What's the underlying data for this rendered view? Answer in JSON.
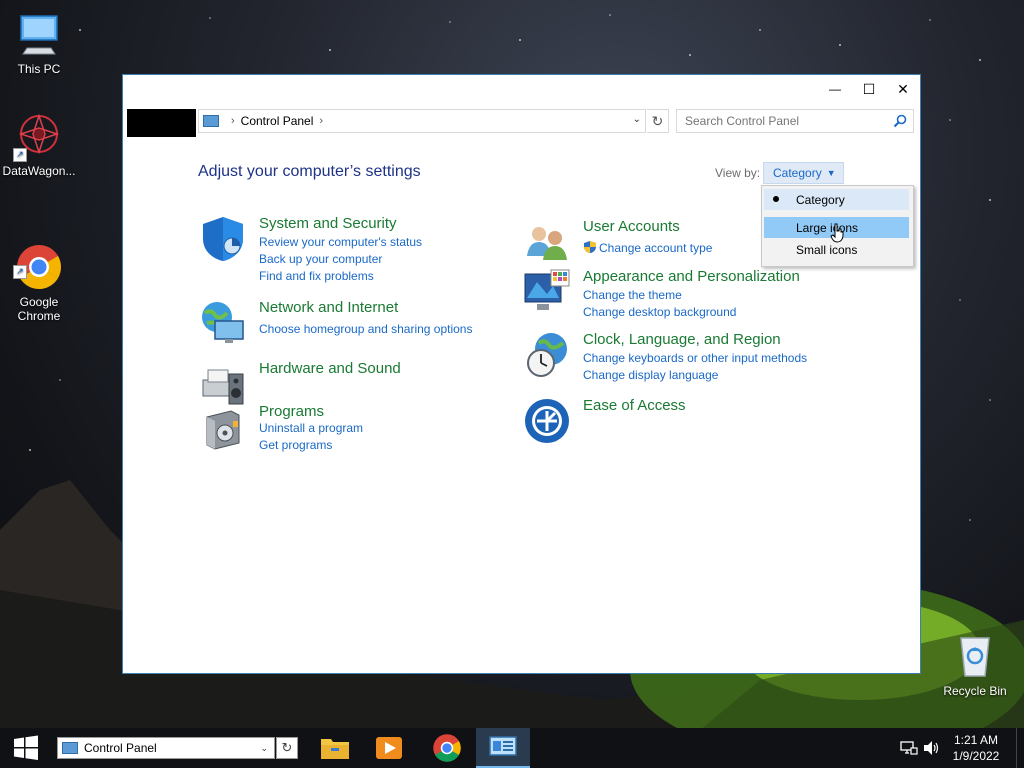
{
  "desktop": {
    "icons": [
      {
        "label": "This PC"
      },
      {
        "label": "DataWagon..."
      },
      {
        "label": "Google\nChrome"
      },
      {
        "label": "Recycle Bin"
      }
    ]
  },
  "window": {
    "controls": {
      "minimize": "—",
      "maximize": "☐",
      "close": "✕"
    },
    "address": {
      "crumb": "Control Panel"
    },
    "search": {
      "placeholder": "Search Control Panel"
    },
    "heading": "Adjust your computer’s settings",
    "view_by": {
      "label": "View by:",
      "selected": "Category",
      "options": [
        "Category",
        "Large icons",
        "Small icons"
      ]
    },
    "categories_left": [
      {
        "title": "System and Security",
        "links": [
          "Review your computer's status",
          "Back up your computer",
          "Find and fix problems"
        ]
      },
      {
        "title": "Network and Internet",
        "links": [
          "Choose homegroup and sharing options"
        ]
      },
      {
        "title": "Hardware and Sound",
        "links": []
      },
      {
        "title": "Programs",
        "links": [
          "Uninstall a program",
          "Get programs"
        ]
      }
    ],
    "categories_right": [
      {
        "title": "User Accounts",
        "links": [
          "Change account type"
        ]
      },
      {
        "title": "Appearance and Personalization",
        "links": [
          "Change the theme",
          "Change desktop background"
        ]
      },
      {
        "title": "Clock, Language, and Region",
        "links": [
          "Change keyboards or other input methods",
          "Change display language"
        ]
      },
      {
        "title": "Ease of Access",
        "links": []
      }
    ]
  },
  "taskbar": {
    "address_text": "Control Panel",
    "apps": [
      "file-explorer",
      "media-player",
      "chrome",
      "control-panel"
    ],
    "time": "1:21 AM",
    "date": "1/9/2022"
  },
  "colors": {
    "category_title": "#1a7a34",
    "link": "#1a69c7",
    "heading": "#1e3287",
    "hover_item": "#91c9f7"
  }
}
